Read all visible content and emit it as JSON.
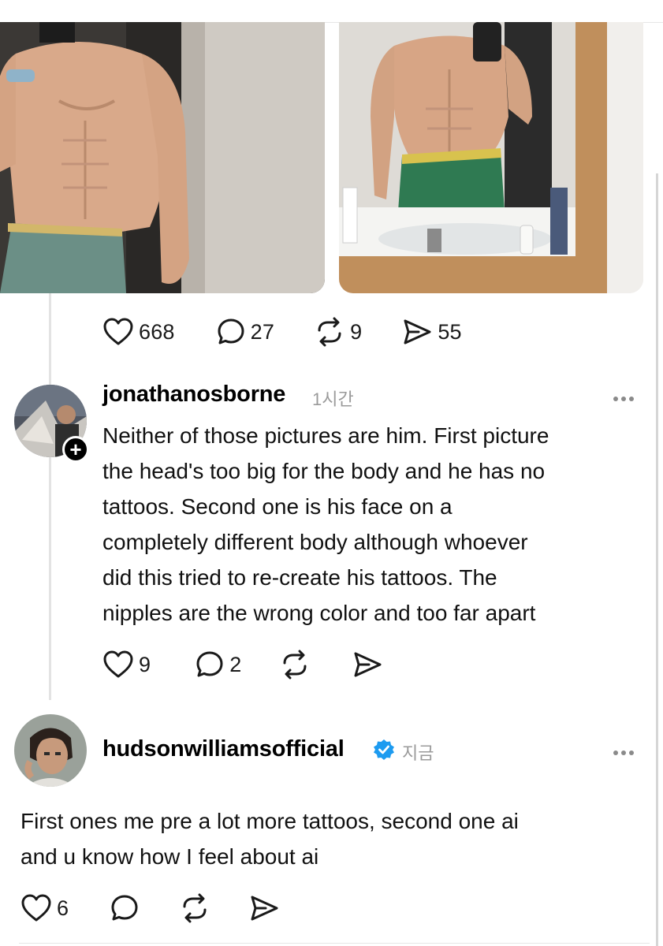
{
  "post": {
    "likes": "668",
    "replies": "27",
    "reposts": "9",
    "shares": "55"
  },
  "comment1": {
    "username": "jonathanosborne",
    "time": "1시간",
    "lines": [
      "Neither of those pictures are him.  First picture",
      "the head's too big for the body and he has no",
      "tattoos.  Second one is his face on a",
      "completely different body although whoever",
      "did this tried to re-create his tattoos.  The",
      "nipples are the wrong color and too far apart"
    ],
    "likes": "9",
    "replies": "2",
    "follow_badge": "+"
  },
  "comment2": {
    "username": "hudsonwilliamsofficial",
    "time": "지금",
    "verified_color": "#1d9bf0",
    "lines": [
      "First ones me pre a lot more tattoos, second one ai",
      "and u know how I feel about ai"
    ],
    "likes": "6"
  },
  "icons": {
    "like": "heart-icon",
    "reply": "comment-bubble-icon",
    "repost": "repost-icon",
    "share": "send-icon",
    "more": "more-dots-icon"
  }
}
